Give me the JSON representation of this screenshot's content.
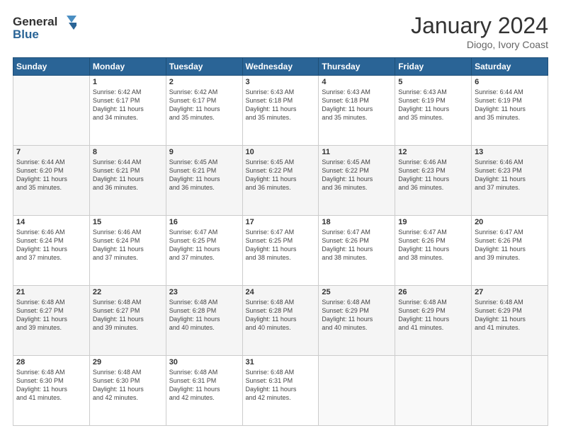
{
  "header": {
    "logo_line1": "General",
    "logo_line2": "Blue",
    "title": "January 2024",
    "subtitle": "Diogo, Ivory Coast"
  },
  "weekdays": [
    "Sunday",
    "Monday",
    "Tuesday",
    "Wednesday",
    "Thursday",
    "Friday",
    "Saturday"
  ],
  "weeks": [
    [
      {
        "day": "",
        "sunrise": "",
        "sunset": "",
        "daylight": ""
      },
      {
        "day": "1",
        "sunrise": "Sunrise: 6:42 AM",
        "sunset": "Sunset: 6:17 PM",
        "daylight": "Daylight: 11 hours and 34 minutes."
      },
      {
        "day": "2",
        "sunrise": "Sunrise: 6:42 AM",
        "sunset": "Sunset: 6:17 PM",
        "daylight": "Daylight: 11 hours and 35 minutes."
      },
      {
        "day": "3",
        "sunrise": "Sunrise: 6:43 AM",
        "sunset": "Sunset: 6:18 PM",
        "daylight": "Daylight: 11 hours and 35 minutes."
      },
      {
        "day": "4",
        "sunrise": "Sunrise: 6:43 AM",
        "sunset": "Sunset: 6:18 PM",
        "daylight": "Daylight: 11 hours and 35 minutes."
      },
      {
        "day": "5",
        "sunrise": "Sunrise: 6:43 AM",
        "sunset": "Sunset: 6:19 PM",
        "daylight": "Daylight: 11 hours and 35 minutes."
      },
      {
        "day": "6",
        "sunrise": "Sunrise: 6:44 AM",
        "sunset": "Sunset: 6:19 PM",
        "daylight": "Daylight: 11 hours and 35 minutes."
      }
    ],
    [
      {
        "day": "7",
        "sunrise": "Sunrise: 6:44 AM",
        "sunset": "Sunset: 6:20 PM",
        "daylight": "Daylight: 11 hours and 35 minutes."
      },
      {
        "day": "8",
        "sunrise": "Sunrise: 6:44 AM",
        "sunset": "Sunset: 6:21 PM",
        "daylight": "Daylight: 11 hours and 36 minutes."
      },
      {
        "day": "9",
        "sunrise": "Sunrise: 6:45 AM",
        "sunset": "Sunset: 6:21 PM",
        "daylight": "Daylight: 11 hours and 36 minutes."
      },
      {
        "day": "10",
        "sunrise": "Sunrise: 6:45 AM",
        "sunset": "Sunset: 6:22 PM",
        "daylight": "Daylight: 11 hours and 36 minutes."
      },
      {
        "day": "11",
        "sunrise": "Sunrise: 6:45 AM",
        "sunset": "Sunset: 6:22 PM",
        "daylight": "Daylight: 11 hours and 36 minutes."
      },
      {
        "day": "12",
        "sunrise": "Sunrise: 6:46 AM",
        "sunset": "Sunset: 6:23 PM",
        "daylight": "Daylight: 11 hours and 36 minutes."
      },
      {
        "day": "13",
        "sunrise": "Sunrise: 6:46 AM",
        "sunset": "Sunset: 6:23 PM",
        "daylight": "Daylight: 11 hours and 37 minutes."
      }
    ],
    [
      {
        "day": "14",
        "sunrise": "Sunrise: 6:46 AM",
        "sunset": "Sunset: 6:24 PM",
        "daylight": "Daylight: 11 hours and 37 minutes."
      },
      {
        "day": "15",
        "sunrise": "Sunrise: 6:46 AM",
        "sunset": "Sunset: 6:24 PM",
        "daylight": "Daylight: 11 hours and 37 minutes."
      },
      {
        "day": "16",
        "sunrise": "Sunrise: 6:47 AM",
        "sunset": "Sunset: 6:25 PM",
        "daylight": "Daylight: 11 hours and 37 minutes."
      },
      {
        "day": "17",
        "sunrise": "Sunrise: 6:47 AM",
        "sunset": "Sunset: 6:25 PM",
        "daylight": "Daylight: 11 hours and 38 minutes."
      },
      {
        "day": "18",
        "sunrise": "Sunrise: 6:47 AM",
        "sunset": "Sunset: 6:26 PM",
        "daylight": "Daylight: 11 hours and 38 minutes."
      },
      {
        "day": "19",
        "sunrise": "Sunrise: 6:47 AM",
        "sunset": "Sunset: 6:26 PM",
        "daylight": "Daylight: 11 hours and 38 minutes."
      },
      {
        "day": "20",
        "sunrise": "Sunrise: 6:47 AM",
        "sunset": "Sunset: 6:26 PM",
        "daylight": "Daylight: 11 hours and 39 minutes."
      }
    ],
    [
      {
        "day": "21",
        "sunrise": "Sunrise: 6:48 AM",
        "sunset": "Sunset: 6:27 PM",
        "daylight": "Daylight: 11 hours and 39 minutes."
      },
      {
        "day": "22",
        "sunrise": "Sunrise: 6:48 AM",
        "sunset": "Sunset: 6:27 PM",
        "daylight": "Daylight: 11 hours and 39 minutes."
      },
      {
        "day": "23",
        "sunrise": "Sunrise: 6:48 AM",
        "sunset": "Sunset: 6:28 PM",
        "daylight": "Daylight: 11 hours and 40 minutes."
      },
      {
        "day": "24",
        "sunrise": "Sunrise: 6:48 AM",
        "sunset": "Sunset: 6:28 PM",
        "daylight": "Daylight: 11 hours and 40 minutes."
      },
      {
        "day": "25",
        "sunrise": "Sunrise: 6:48 AM",
        "sunset": "Sunset: 6:29 PM",
        "daylight": "Daylight: 11 hours and 40 minutes."
      },
      {
        "day": "26",
        "sunrise": "Sunrise: 6:48 AM",
        "sunset": "Sunset: 6:29 PM",
        "daylight": "Daylight: 11 hours and 41 minutes."
      },
      {
        "day": "27",
        "sunrise": "Sunrise: 6:48 AM",
        "sunset": "Sunset: 6:29 PM",
        "daylight": "Daylight: 11 hours and 41 minutes."
      }
    ],
    [
      {
        "day": "28",
        "sunrise": "Sunrise: 6:48 AM",
        "sunset": "Sunset: 6:30 PM",
        "daylight": "Daylight: 11 hours and 41 minutes."
      },
      {
        "day": "29",
        "sunrise": "Sunrise: 6:48 AM",
        "sunset": "Sunset: 6:30 PM",
        "daylight": "Daylight: 11 hours and 42 minutes."
      },
      {
        "day": "30",
        "sunrise": "Sunrise: 6:48 AM",
        "sunset": "Sunset: 6:31 PM",
        "daylight": "Daylight: 11 hours and 42 minutes."
      },
      {
        "day": "31",
        "sunrise": "Sunrise: 6:48 AM",
        "sunset": "Sunset: 6:31 PM",
        "daylight": "Daylight: 11 hours and 42 minutes."
      },
      {
        "day": "",
        "sunrise": "",
        "sunset": "",
        "daylight": ""
      },
      {
        "day": "",
        "sunrise": "",
        "sunset": "",
        "daylight": ""
      },
      {
        "day": "",
        "sunrise": "",
        "sunset": "",
        "daylight": ""
      }
    ]
  ]
}
